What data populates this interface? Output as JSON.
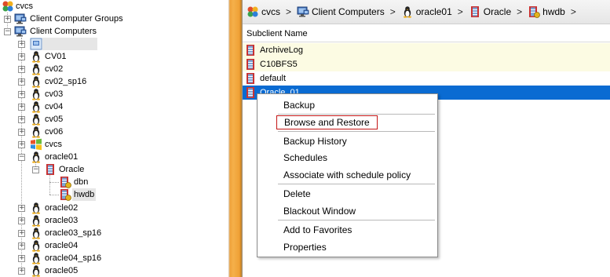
{
  "tree": {
    "root": "cvcs",
    "groups": "Client Computer Groups",
    "clients": "Client Computers",
    "nodes": [
      "CV01",
      "cv02",
      "cv02_sp16",
      "cv03",
      "cv04",
      "cv05",
      "cv06",
      "cvcs",
      "oracle01",
      "Oracle",
      "dbn",
      "hwdb",
      "oracle02",
      "oracle03",
      "oracle03_sp16",
      "oracle04",
      "oracle04_sp16",
      "oracle05"
    ]
  },
  "breadcrumb": [
    "cvcs",
    "Client Computers",
    "oracle01",
    "Oracle",
    "hwdb"
  ],
  "breadcrumb_sep": ">",
  "table": {
    "column": "Subclient Name",
    "rows": [
      "ArchiveLog",
      "C10BFS5",
      "default",
      "Oracle_01"
    ]
  },
  "context_menu": {
    "items": [
      "Backup",
      "Browse and Restore",
      "Backup History",
      "Schedules",
      "Associate with schedule policy",
      "Delete",
      "Blackout Window",
      "Add to Favorites",
      "Properties"
    ]
  },
  "colors": {
    "selection": "#0a6bd2",
    "highlight_box": "#c41515",
    "splitter": "#f0a23a"
  }
}
